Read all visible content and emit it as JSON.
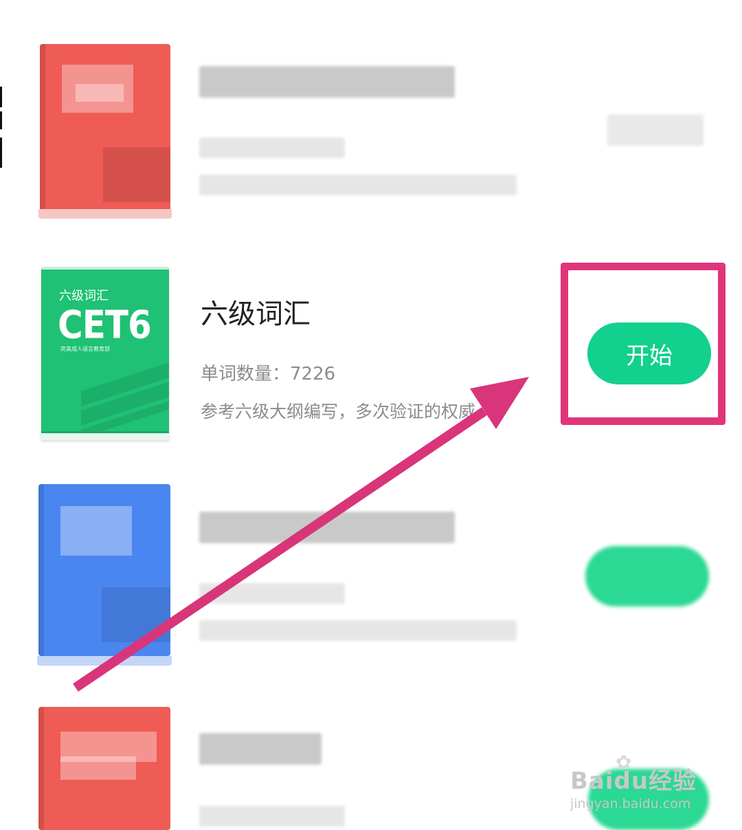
{
  "book_list": {
    "featured_book": {
      "cover": {
        "small_title": "六级词汇",
        "big_title": "CET6",
        "publisher": "完美成人语言教育部"
      },
      "title": "六级词汇",
      "word_count": "单词数量：7226",
      "description": "参考六级大纲编写，多次验证的权威...",
      "start_button": "开始"
    }
  },
  "watermark": {
    "main": "Baidu经验",
    "sub": "jingyan.baidu.com"
  },
  "colors": {
    "accent_green": "#12d08d",
    "highlight_magenta": "#e0357a",
    "cover_red": "#ef5b55",
    "cover_blue": "#4a86f0",
    "cover_green": "#1fc174"
  }
}
